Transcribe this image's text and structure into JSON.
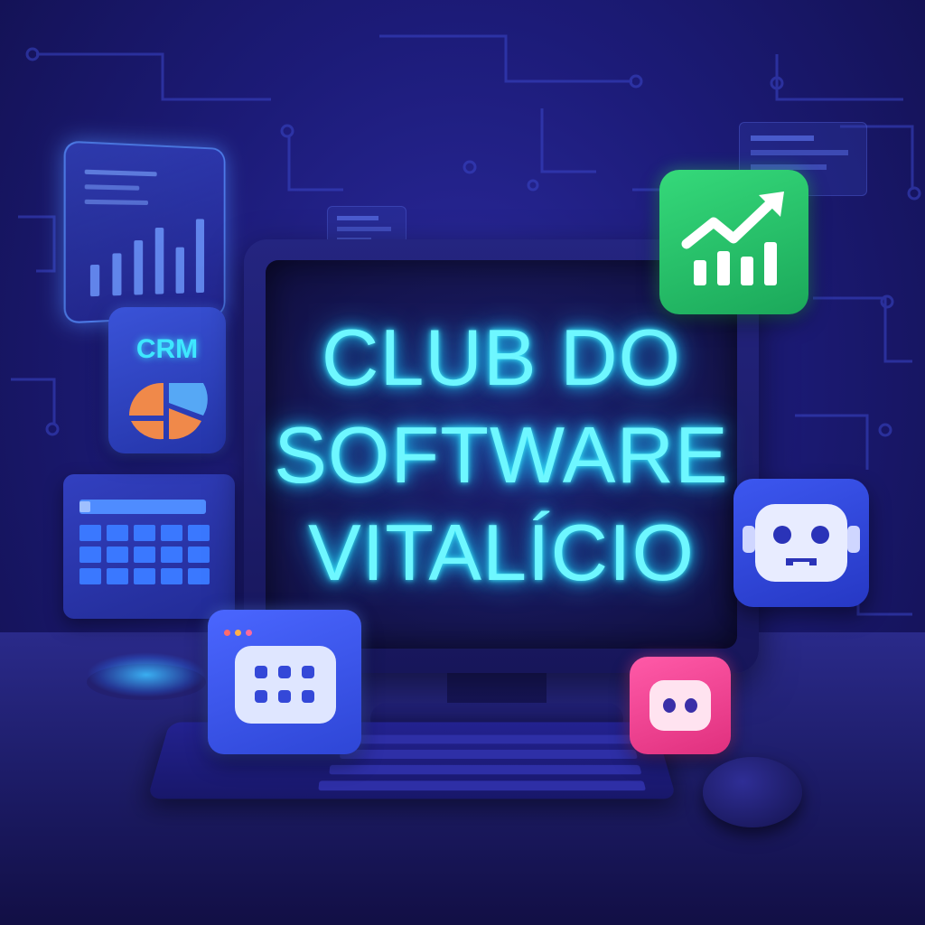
{
  "title": {
    "line1": "CLUB DO",
    "line2": "SOFTWARE",
    "line3": "VITALÍCIO"
  },
  "tiles": {
    "crm_label": "CRM"
  },
  "colors": {
    "neon_text": "#6ef7ff",
    "background": "#1c1b78",
    "growth_tile": "#35d97a",
    "bot_tile": "#3c57f0",
    "pink_tile": "#ff5aa8",
    "crm_orange": "#f0894a",
    "crm_blue": "#56a8f5"
  },
  "icons": [
    "bar-chart-panel",
    "crm-pie-icon",
    "table-grid-panel",
    "app-grid-icon",
    "growth-chart-icon",
    "robot-face-icon",
    "bot-face-icon",
    "mouse"
  ]
}
